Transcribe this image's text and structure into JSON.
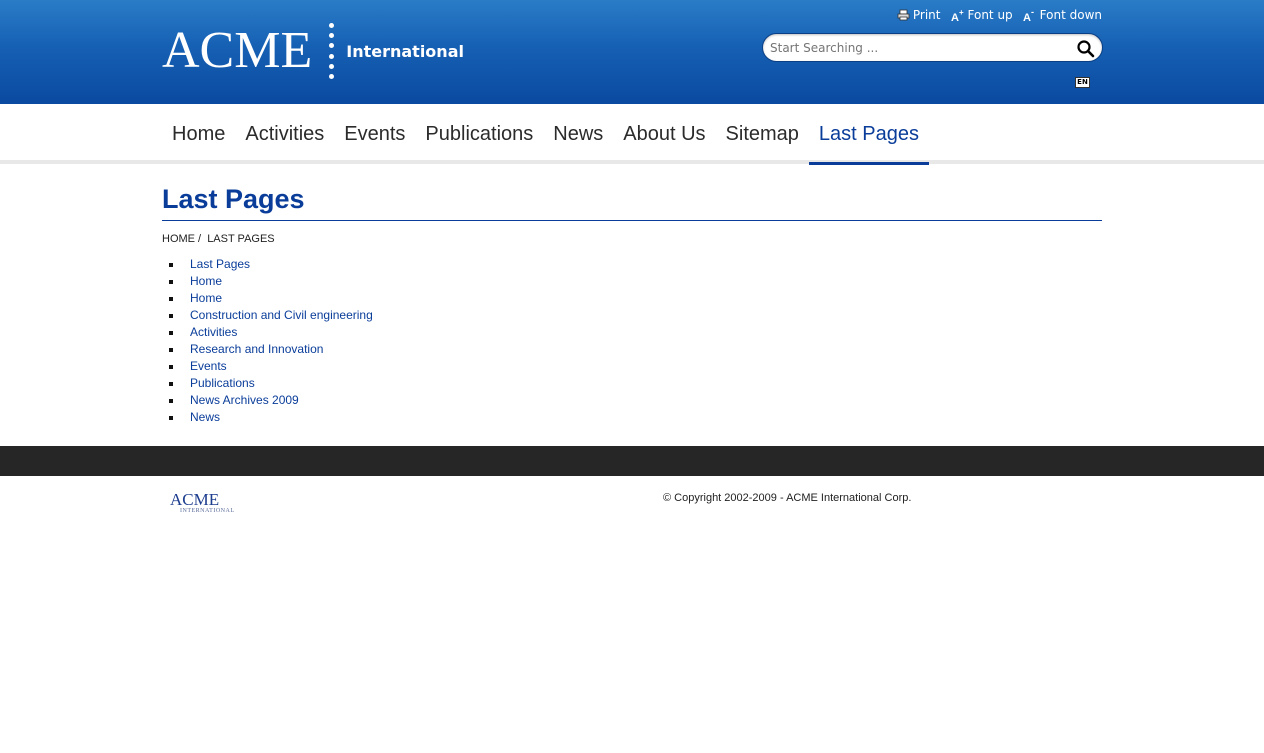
{
  "header": {
    "logo_text": "ACME",
    "logo_subtitle": "International",
    "tools": {
      "print_label": "Print",
      "font_up_label": "Font up",
      "font_down_label": "Font down"
    },
    "search": {
      "placeholder": "Start Searching ...",
      "value": ""
    },
    "language": "EN"
  },
  "nav": {
    "items": [
      "Home",
      "Activities",
      "Events",
      "Publications",
      "News",
      "About Us",
      "Sitemap",
      "Last Pages"
    ],
    "active": "Last Pages"
  },
  "main": {
    "title": "Last Pages",
    "breadcrumb": [
      "HOME /",
      "LAST PAGES"
    ],
    "pages": [
      "Last Pages",
      "Home",
      "Home",
      "Construction and Civil engineering",
      "Activities",
      "Research and Innovation",
      "Events",
      "Publications",
      "News Archives 2009",
      "News"
    ]
  },
  "footer": {
    "logo_text": "ACME",
    "logo_subtitle": "INTERNATIONAL",
    "copyright": "© Copyright 2002-2009 - ACME International Corp."
  },
  "colors": {
    "header_blue": "#1660b4",
    "link_blue": "#0a3d9a",
    "footer_bar": "#262626"
  }
}
